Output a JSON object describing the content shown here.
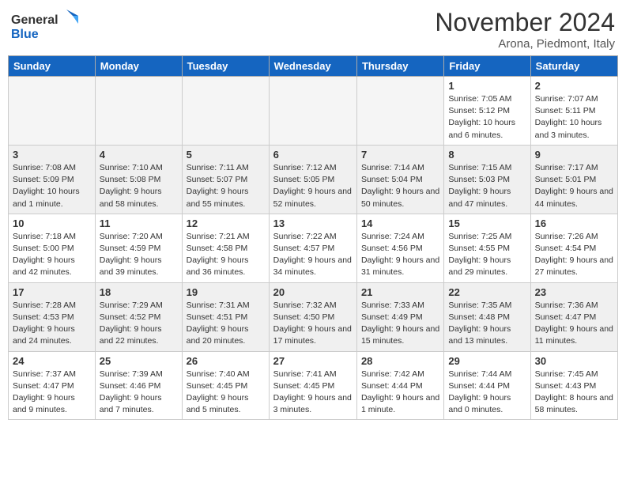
{
  "header": {
    "logo_general": "General",
    "logo_blue": "Blue",
    "month": "November 2024",
    "location": "Arona, Piedmont, Italy"
  },
  "days_of_week": [
    "Sunday",
    "Monday",
    "Tuesday",
    "Wednesday",
    "Thursday",
    "Friday",
    "Saturday"
  ],
  "weeks": [
    {
      "days": [
        {
          "num": "",
          "info": ""
        },
        {
          "num": "",
          "info": ""
        },
        {
          "num": "",
          "info": ""
        },
        {
          "num": "",
          "info": ""
        },
        {
          "num": "",
          "info": ""
        },
        {
          "num": "1",
          "info": "Sunrise: 7:05 AM\nSunset: 5:12 PM\nDaylight: 10 hours and 6 minutes."
        },
        {
          "num": "2",
          "info": "Sunrise: 7:07 AM\nSunset: 5:11 PM\nDaylight: 10 hours and 3 minutes."
        }
      ]
    },
    {
      "days": [
        {
          "num": "3",
          "info": "Sunrise: 7:08 AM\nSunset: 5:09 PM\nDaylight: 10 hours and 1 minute."
        },
        {
          "num": "4",
          "info": "Sunrise: 7:10 AM\nSunset: 5:08 PM\nDaylight: 9 hours and 58 minutes."
        },
        {
          "num": "5",
          "info": "Sunrise: 7:11 AM\nSunset: 5:07 PM\nDaylight: 9 hours and 55 minutes."
        },
        {
          "num": "6",
          "info": "Sunrise: 7:12 AM\nSunset: 5:05 PM\nDaylight: 9 hours and 52 minutes."
        },
        {
          "num": "7",
          "info": "Sunrise: 7:14 AM\nSunset: 5:04 PM\nDaylight: 9 hours and 50 minutes."
        },
        {
          "num": "8",
          "info": "Sunrise: 7:15 AM\nSunset: 5:03 PM\nDaylight: 9 hours and 47 minutes."
        },
        {
          "num": "9",
          "info": "Sunrise: 7:17 AM\nSunset: 5:01 PM\nDaylight: 9 hours and 44 minutes."
        }
      ]
    },
    {
      "days": [
        {
          "num": "10",
          "info": "Sunrise: 7:18 AM\nSunset: 5:00 PM\nDaylight: 9 hours and 42 minutes."
        },
        {
          "num": "11",
          "info": "Sunrise: 7:20 AM\nSunset: 4:59 PM\nDaylight: 9 hours and 39 minutes."
        },
        {
          "num": "12",
          "info": "Sunrise: 7:21 AM\nSunset: 4:58 PM\nDaylight: 9 hours and 36 minutes."
        },
        {
          "num": "13",
          "info": "Sunrise: 7:22 AM\nSunset: 4:57 PM\nDaylight: 9 hours and 34 minutes."
        },
        {
          "num": "14",
          "info": "Sunrise: 7:24 AM\nSunset: 4:56 PM\nDaylight: 9 hours and 31 minutes."
        },
        {
          "num": "15",
          "info": "Sunrise: 7:25 AM\nSunset: 4:55 PM\nDaylight: 9 hours and 29 minutes."
        },
        {
          "num": "16",
          "info": "Sunrise: 7:26 AM\nSunset: 4:54 PM\nDaylight: 9 hours and 27 minutes."
        }
      ]
    },
    {
      "days": [
        {
          "num": "17",
          "info": "Sunrise: 7:28 AM\nSunset: 4:53 PM\nDaylight: 9 hours and 24 minutes."
        },
        {
          "num": "18",
          "info": "Sunrise: 7:29 AM\nSunset: 4:52 PM\nDaylight: 9 hours and 22 minutes."
        },
        {
          "num": "19",
          "info": "Sunrise: 7:31 AM\nSunset: 4:51 PM\nDaylight: 9 hours and 20 minutes."
        },
        {
          "num": "20",
          "info": "Sunrise: 7:32 AM\nSunset: 4:50 PM\nDaylight: 9 hours and 17 minutes."
        },
        {
          "num": "21",
          "info": "Sunrise: 7:33 AM\nSunset: 4:49 PM\nDaylight: 9 hours and 15 minutes."
        },
        {
          "num": "22",
          "info": "Sunrise: 7:35 AM\nSunset: 4:48 PM\nDaylight: 9 hours and 13 minutes."
        },
        {
          "num": "23",
          "info": "Sunrise: 7:36 AM\nSunset: 4:47 PM\nDaylight: 9 hours and 11 minutes."
        }
      ]
    },
    {
      "days": [
        {
          "num": "24",
          "info": "Sunrise: 7:37 AM\nSunset: 4:47 PM\nDaylight: 9 hours and 9 minutes."
        },
        {
          "num": "25",
          "info": "Sunrise: 7:39 AM\nSunset: 4:46 PM\nDaylight: 9 hours and 7 minutes."
        },
        {
          "num": "26",
          "info": "Sunrise: 7:40 AM\nSunset: 4:45 PM\nDaylight: 9 hours and 5 minutes."
        },
        {
          "num": "27",
          "info": "Sunrise: 7:41 AM\nSunset: 4:45 PM\nDaylight: 9 hours and 3 minutes."
        },
        {
          "num": "28",
          "info": "Sunrise: 7:42 AM\nSunset: 4:44 PM\nDaylight: 9 hours and 1 minute."
        },
        {
          "num": "29",
          "info": "Sunrise: 7:44 AM\nSunset: 4:44 PM\nDaylight: 9 hours and 0 minutes."
        },
        {
          "num": "30",
          "info": "Sunrise: 7:45 AM\nSunset: 4:43 PM\nDaylight: 8 hours and 58 minutes."
        }
      ]
    }
  ]
}
